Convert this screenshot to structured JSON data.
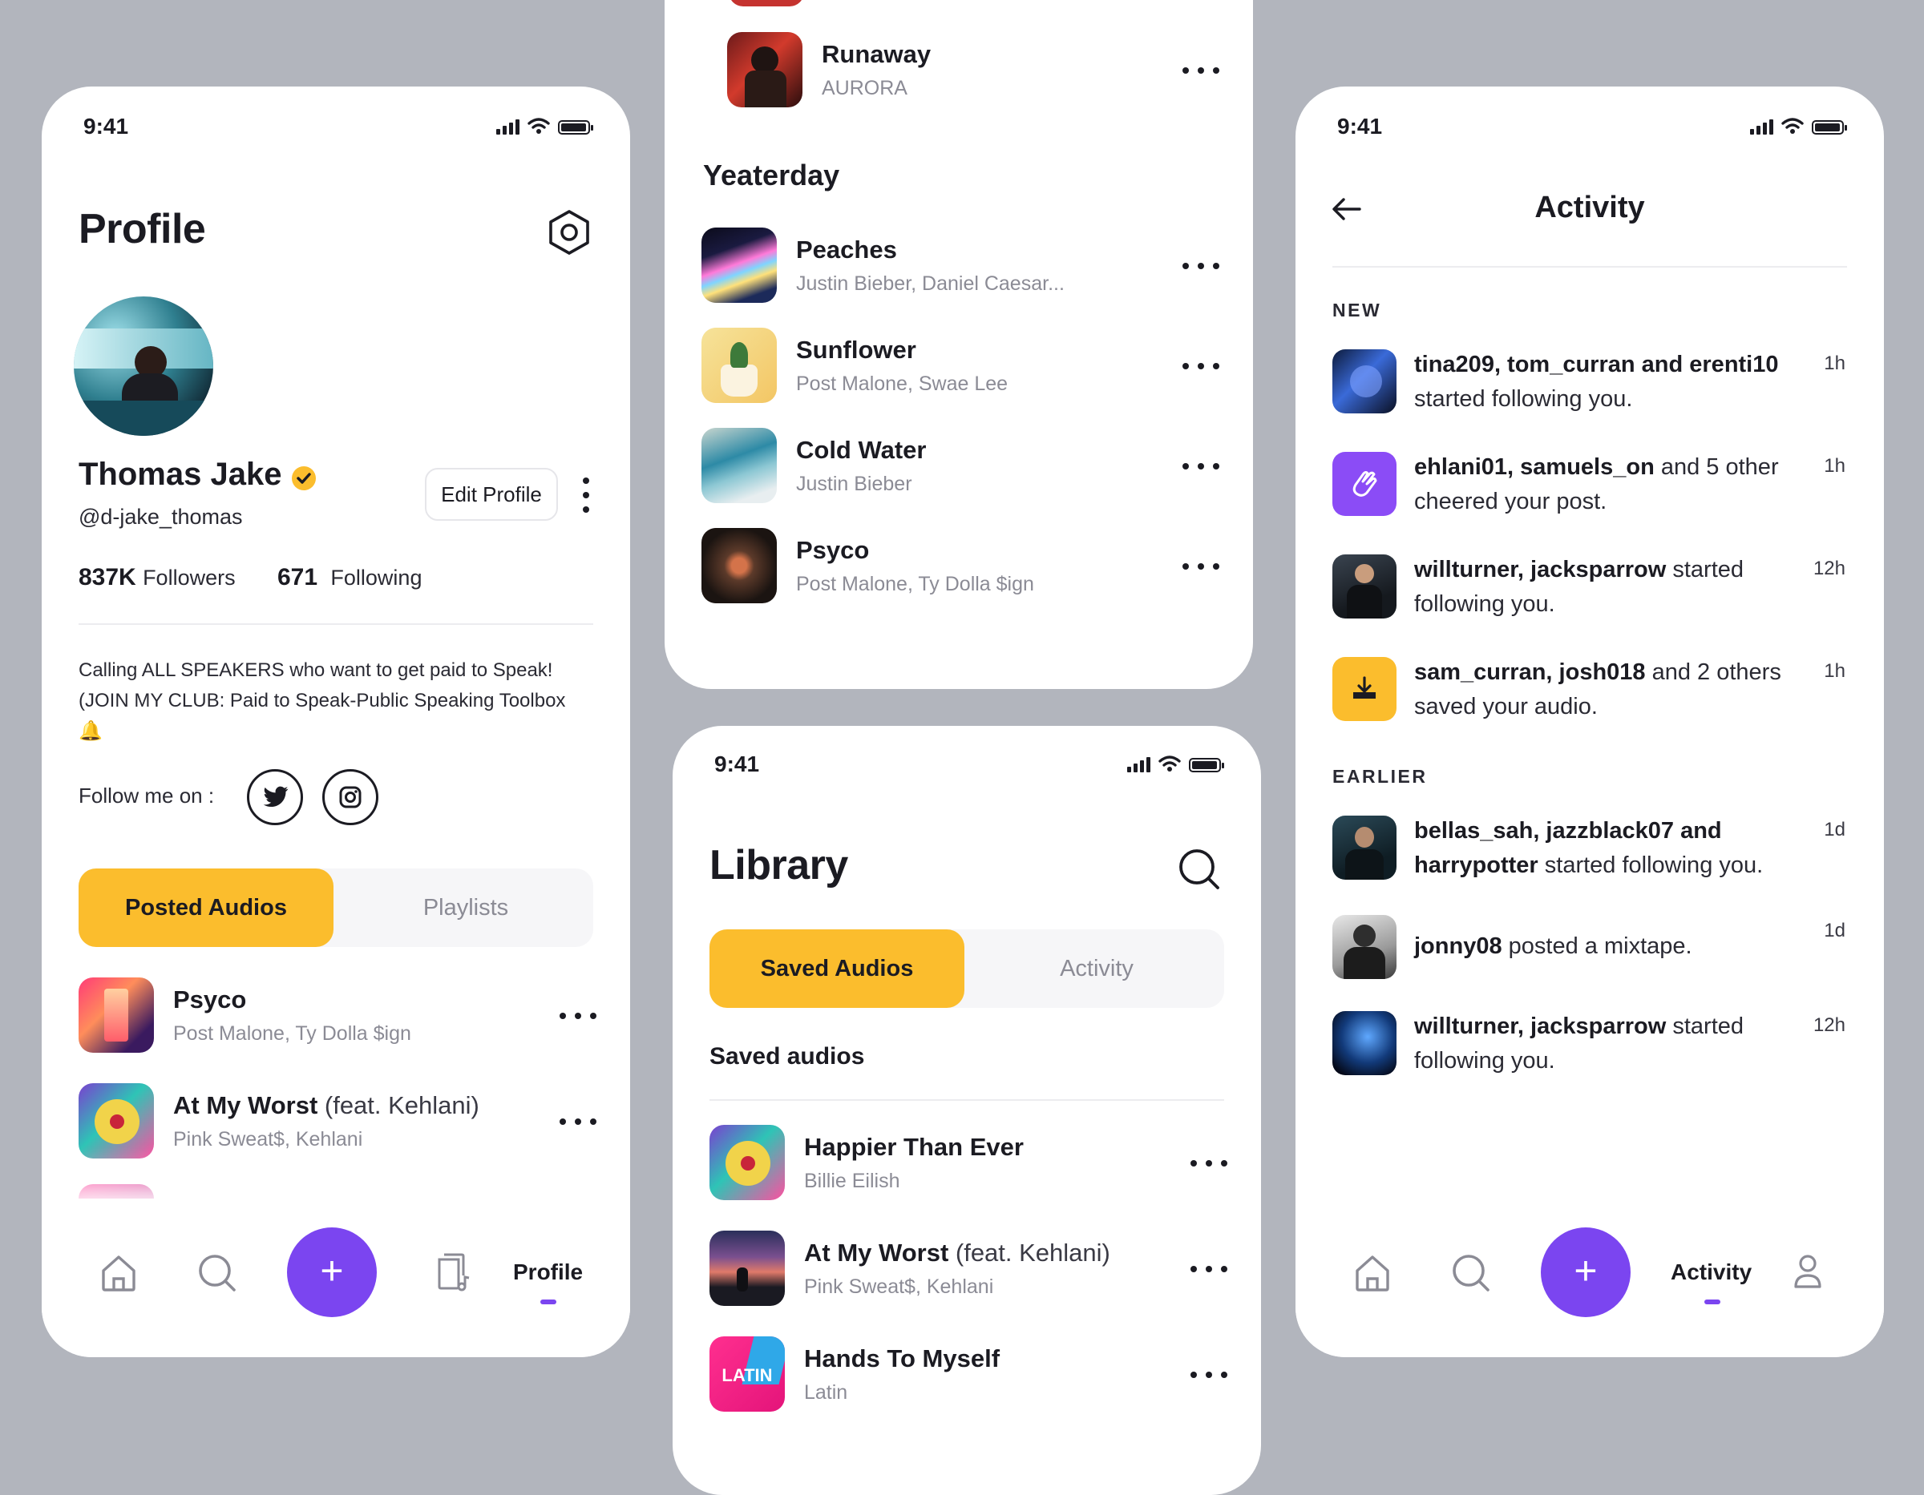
{
  "status_time": "9:41",
  "profile": {
    "title": "Profile",
    "name": "Thomas Jake",
    "handle": "@d-jake_thomas",
    "edit_label": "Edit Profile",
    "followers_count": "837K",
    "followers_label": "Followers",
    "following_count": "671",
    "following_label": "Following",
    "bio_line1": "Calling  ALL SPEAKERS who want to get paid to Speak!",
    "bio_line2": "(JOIN MY CLUB: Paid to Speak-Public Speaking Toolbox",
    "bio_emoji": "🔔",
    "follow_label": "Follow me on :",
    "tab_active": "Posted Audios",
    "tab_inactive": "Playlists",
    "songs": [
      {
        "title": "Psyco",
        "title_extra": "",
        "artist": "Post Malone, Ty Dolla $ign"
      },
      {
        "title": "At My Worst",
        "title_extra": " (feat. Kehlani)",
        "artist": "Pink Sweat$, Kehlani"
      }
    ],
    "nav_label": "Profile"
  },
  "history": {
    "top_song": {
      "title": "Runaway",
      "artist": "AURORA"
    },
    "section": "Yeaterday",
    "songs": [
      {
        "title": "Peaches",
        "artist": "Justin Bieber, Daniel Caesar..."
      },
      {
        "title": "Sunflower",
        "artist": "Post Malone, Swae Lee"
      },
      {
        "title": "Cold Water",
        "artist": "Justin Bieber"
      },
      {
        "title": "Psyco",
        "artist": "Post Malone, Ty Dolla $ign"
      }
    ]
  },
  "library": {
    "title": "Library",
    "tab_active": "Saved Audios",
    "tab_inactive": "Activity",
    "section": "Saved audios",
    "songs": [
      {
        "title": "Happier Than Ever",
        "title_extra": "",
        "artist": "Billie Eilish"
      },
      {
        "title": "At My Worst",
        "title_extra": " (feat. Kehlani)",
        "artist": "Pink Sweat$, Kehlani"
      },
      {
        "title": "Hands To Myself",
        "title_extra": "",
        "artist": "Latin"
      }
    ],
    "cover_text": "LATIN"
  },
  "activity": {
    "title": "Activity",
    "section_new": "NEW",
    "section_earlier": "EARLIER",
    "items": [
      {
        "bold": "tina209, tom_curran and erenti10",
        "rest": " started following you.",
        "time": "1h"
      },
      {
        "bold": "ehlani01, samuels_on",
        "rest": " and 5 other cheered your post.",
        "time": "1h"
      },
      {
        "bold": "willturner, jacksparrow",
        "rest": " started following you.",
        "time": "12h"
      },
      {
        "bold": "sam_curran, josh018",
        "rest": " and 2 others saved your audio.",
        "time": "1h"
      },
      {
        "bold": "bellas_sah, jazzblack07 and harrypotter",
        "rest": " started following you.",
        "time": "1d"
      },
      {
        "bold": "jonny08",
        "rest": " posted a mixtape.",
        "time": "1d"
      },
      {
        "bold": "willturner, jacksparrow",
        "rest": " started following you.",
        "time": "12h"
      }
    ],
    "nav_label": "Activity"
  },
  "colors": {
    "accent_yellow": "#fbbd2d",
    "accent_purple": "#7b45f0",
    "background": "#b2b5bd"
  },
  "icons": [
    "settings-hex-icon",
    "verified-badge-icon",
    "more-vertical-icon",
    "twitter-icon",
    "instagram-icon",
    "home-icon",
    "search-icon",
    "plus-icon",
    "library-icon",
    "back-arrow-icon",
    "clap-icon",
    "download-icon",
    "user-icon"
  ]
}
